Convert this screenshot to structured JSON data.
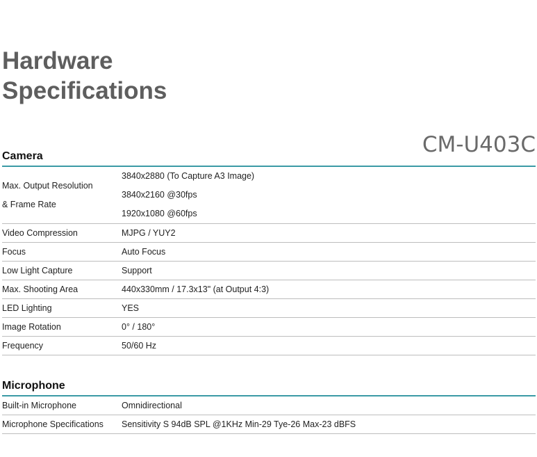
{
  "title": {
    "line1": "Hardware",
    "line2": "Specifications"
  },
  "model": "CM-U403C",
  "camera": {
    "heading": "Camera",
    "rows": [
      {
        "label_lines": [
          "Max. Output Resolution",
          "& Frame Rate"
        ],
        "values": [
          "3840x2880 (To Capture A3 Image)",
          "3840x2160 @30fps",
          "1920x1080 @60fps"
        ]
      },
      {
        "label": "Video Compression",
        "value": "MJPG / YUY2"
      },
      {
        "label": "Focus",
        "value": "Auto Focus"
      },
      {
        "label": "Low Light Capture",
        "value": "Support"
      },
      {
        "label": "Max. Shooting Area",
        "value": "440x330mm /  17.3x13\" (at Output 4:3)"
      },
      {
        "label": "LED Lighting",
        "value": "YES"
      },
      {
        "label": "Image Rotation",
        "value": "0° / 180°"
      },
      {
        "label": "Frequency",
        "value": "50/60 Hz"
      }
    ]
  },
  "microphone": {
    "heading": "Microphone",
    "rows": [
      {
        "label": "Built-in Microphone",
        "value": "Omnidirectional"
      },
      {
        "label": "Microphone Specifications",
        "value": "Sensitivity S 94dB SPL @1KHz Min-29 Tye-26 Max-23 dBFS"
      }
    ]
  },
  "colors": {
    "accent": "#3a9aa5",
    "title": "#5e5e5e",
    "divider": "#bdbdbd"
  }
}
